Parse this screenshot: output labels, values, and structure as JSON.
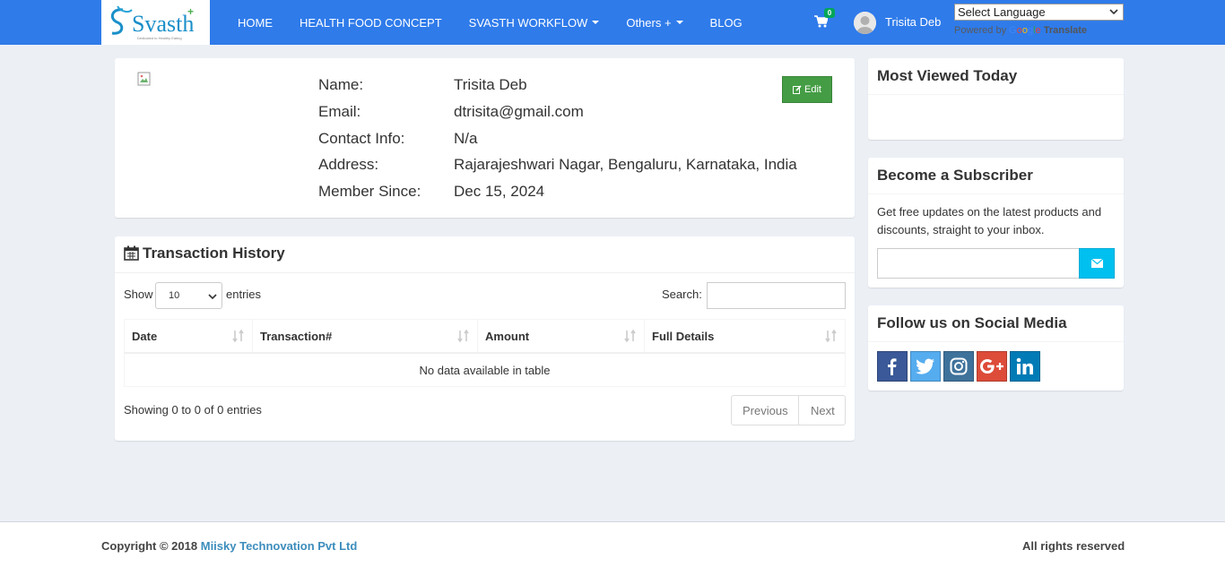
{
  "brand": {
    "logo_text": "Svasth",
    "logo_tagline": "Dedicated to Healthy Eating"
  },
  "nav": {
    "items": [
      {
        "label": "HOME"
      },
      {
        "label": "HEALTH FOOD CONCEPT"
      },
      {
        "label": "SVASTH WORKFLOW"
      },
      {
        "label": "Others +"
      },
      {
        "label": "BLOG"
      }
    ],
    "cart_count": "0",
    "user_name": "Trisita Deb",
    "language_select": "Select Language",
    "powered_by": "Powered by",
    "google": [
      "G",
      "o",
      "o",
      "g",
      "l",
      "e"
    ],
    "translate": "Translate"
  },
  "profile": {
    "fields": [
      {
        "label": "Name:",
        "value": "Trisita Deb"
      },
      {
        "label": "Email:",
        "value": "dtrisita@gmail.com"
      },
      {
        "label": "Contact Info:",
        "value": "N/a"
      },
      {
        "label": "Address:",
        "value": "Rajarajeshwari Nagar, Bengaluru, Karnataka, India"
      },
      {
        "label": "Member Since:",
        "value": "Dec 15, 2024"
      }
    ],
    "edit_label": "Edit"
  },
  "transactions": {
    "title": "Transaction History",
    "show_label": "Show",
    "page_size": "10",
    "entries_label": "entries",
    "search_label": "Search:",
    "columns": [
      "Date",
      "Transaction#",
      "Amount",
      "Full Details"
    ],
    "empty_text": "No data available in table",
    "showing_text": "Showing 0 to 0 of 0 entries",
    "prev_label": "Previous",
    "next_label": "Next"
  },
  "sidebar": {
    "most_viewed_title": "Most Viewed Today",
    "subscribe_title": "Become a Subscriber",
    "subscribe_text": "Get free updates on the latest products and discounts, straight to your inbox.",
    "social_title": "Follow us on Social Media"
  },
  "footer": {
    "copyright_prefix": "Copyright © 2018",
    "company": "Miisky Technovation Pvt Ltd",
    "rights": "All rights reserved"
  },
  "colors": {
    "navbar": "#2f7bea",
    "edit_button": "#449d44",
    "subscribe_button": "#00c0ef",
    "facebook": "#3b5998",
    "twitter": "#55acee",
    "instagram": "#3f729b",
    "google_plus": "#dd4b39",
    "linkedin": "#007bb6"
  }
}
